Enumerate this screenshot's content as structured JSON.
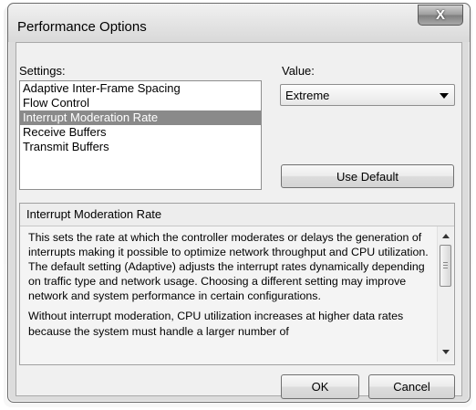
{
  "window": {
    "title": "Performance Options",
    "close_glyph": "X"
  },
  "settings": {
    "label": "Settings:",
    "items": [
      "Adaptive Inter-Frame Spacing",
      "Flow Control",
      "Interrupt Moderation Rate",
      "Receive Buffers",
      "Transmit Buffers"
    ],
    "selected_index": 2
  },
  "value": {
    "label": "Value:",
    "selected": "Extreme"
  },
  "buttons": {
    "use_default": "Use Default",
    "ok": "OK",
    "cancel": "Cancel"
  },
  "description": {
    "title": "Interrupt Moderation Rate",
    "paragraphs": [
      "This sets the rate at which the controller moderates or delays the generation of interrupts making it possible to optimize network throughput and CPU utilization. The default setting (Adaptive) adjusts the interrupt rates dynamically depending on traffic type and network usage. Choosing a different setting may improve network and system performance in certain configurations.",
      "Without interrupt moderation, CPU utilization increases at higher data rates because the system must handle a larger number of"
    ]
  },
  "icons": {
    "close": "close-icon",
    "dropdown": "chevron-down-icon",
    "scroll_up": "arrow-up-icon",
    "scroll_down": "arrow-down-icon"
  },
  "colors": {
    "selection": "#8a8a8a",
    "dialog_bg": "#f0f0f0"
  }
}
